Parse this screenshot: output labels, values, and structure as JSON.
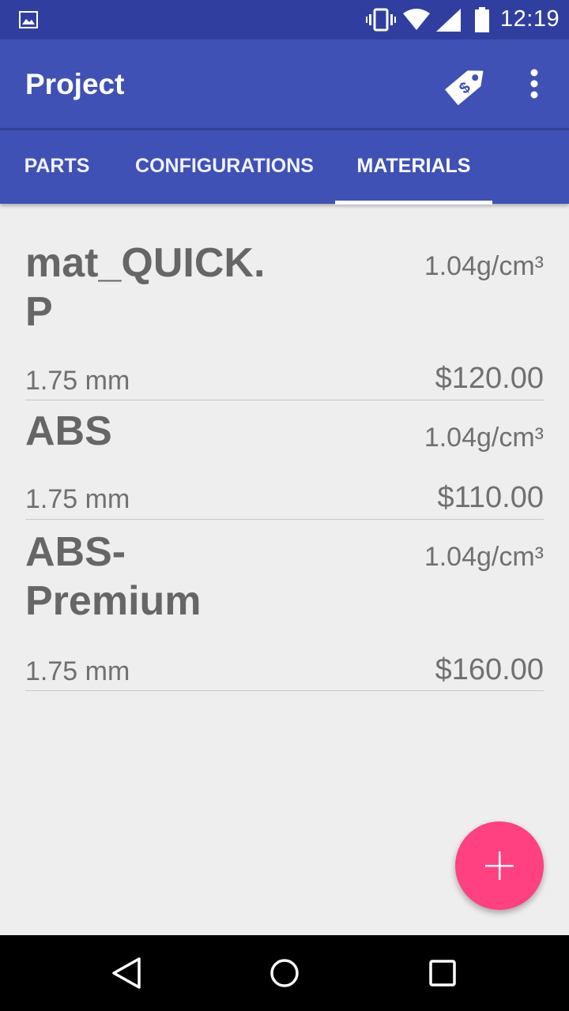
{
  "status_bar": {
    "time": "12:19",
    "icons": [
      "gallery-icon",
      "vibrate-icon",
      "wifi-icon",
      "signal-icon",
      "battery-icon"
    ]
  },
  "app_bar": {
    "title": "Project",
    "actions": [
      "price-tag-icon",
      "overflow-menu-icon"
    ]
  },
  "tabs": [
    {
      "label": "PARTS",
      "selected": false
    },
    {
      "label": "CONFIGURATIONS",
      "selected": false
    },
    {
      "label": "MATERIALS",
      "selected": true
    }
  ],
  "materials": [
    {
      "name": "mat_QUICK.\nP",
      "density": "1.04g/cm³",
      "diameter": "1.75 mm",
      "price": "$120.00"
    },
    {
      "name": "ABS",
      "density": "1.04g/cm³",
      "diameter": "1.75 mm",
      "price": "$110.00"
    },
    {
      "name": "ABS-\nPremium",
      "density": "1.04g/cm³",
      "diameter": "1.75 mm",
      "price": "$160.00"
    }
  ],
  "fab": {
    "icon": "plus-icon"
  },
  "nav_bar": {
    "buttons": [
      "back-icon",
      "home-icon",
      "recents-icon"
    ]
  },
  "colors": {
    "status_bar": "#303f9f",
    "primary": "#3f51b5",
    "accent": "#ff4081",
    "background": "#eeeeee"
  }
}
